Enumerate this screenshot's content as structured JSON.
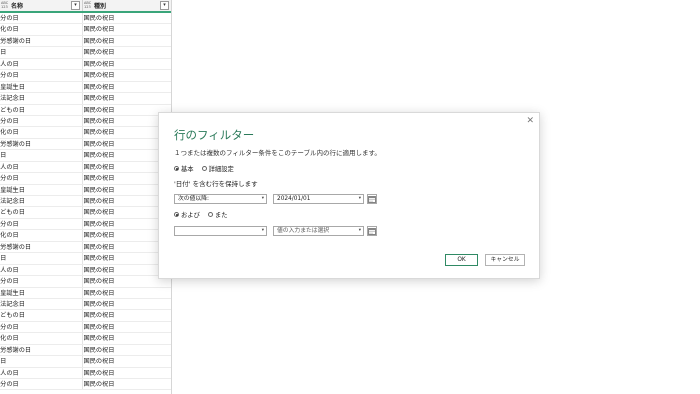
{
  "grid": {
    "columns": [
      {
        "type": "ABC\n123",
        "name": "名称"
      },
      {
        "type": "ABC\n123",
        "name": "種別"
      }
    ],
    "rows": [
      [
        "秋分の日",
        "国民の祝日"
      ],
      [
        "文化の日",
        "国民の祝日"
      ],
      [
        "勤労感謝の日",
        "国民の祝日"
      ],
      [
        "元日",
        "国民の祝日"
      ],
      [
        "成人の日",
        "国民の祝日"
      ],
      [
        "春分の日",
        "国民の祝日"
      ],
      [
        "天皇誕生日",
        "国民の祝日"
      ],
      [
        "憲法記念日",
        "国民の祝日"
      ],
      [
        "こどもの日",
        "国民の祝日"
      ],
      [
        "秋分の日",
        "国民の祝日"
      ],
      [
        "文化の日",
        "国民の祝日"
      ],
      [
        "勤労感謝の日",
        "国民の祝日"
      ],
      [
        "元日",
        "国民の祝日"
      ],
      [
        "成人の日",
        "国民の祝日"
      ],
      [
        "春分の日",
        "国民の祝日"
      ],
      [
        "天皇誕生日",
        "国民の祝日"
      ],
      [
        "憲法記念日",
        "国民の祝日"
      ],
      [
        "こどもの日",
        "国民の祝日"
      ],
      [
        "秋分の日",
        "国民の祝日"
      ],
      [
        "文化の日",
        "国民の祝日"
      ],
      [
        "勤労感謝の日",
        "国民の祝日"
      ],
      [
        "元日",
        "国民の祝日"
      ],
      [
        "成人の日",
        "国民の祝日"
      ],
      [
        "春分の日",
        "国民の祝日"
      ],
      [
        "天皇誕生日",
        "国民の祝日"
      ],
      [
        "憲法記念日",
        "国民の祝日"
      ],
      [
        "こどもの日",
        "国民の祝日"
      ],
      [
        "秋分の日",
        "国民の祝日"
      ],
      [
        "文化の日",
        "国民の祝日"
      ],
      [
        "勤労感謝の日",
        "国民の祝日"
      ],
      [
        "元日",
        "国民の祝日"
      ],
      [
        "成人の日",
        "国民の祝日"
      ],
      [
        "春分の日",
        "国民の祝日"
      ]
    ]
  },
  "dialog": {
    "title": "行のフィルター",
    "description": "１つまたは複数のフィルター条件をこのテーブル内の行に適用します。",
    "mode_basic": "基本",
    "mode_advanced": "詳細設定",
    "keep_rows_text": "'日付' を含む行を保持します",
    "condition1": {
      "operator": "次の値以降:",
      "value": "2024/01/01"
    },
    "logic_and": "および",
    "logic_or": "また",
    "condition2": {
      "operator": "",
      "value_placeholder": "値の入力または選択"
    },
    "ok_label": "OK",
    "cancel_label": "キャンセル",
    "close_glyph": "✕"
  },
  "colors": {
    "accent": "#2b7a5a",
    "header_underline": "#3aa57a"
  }
}
